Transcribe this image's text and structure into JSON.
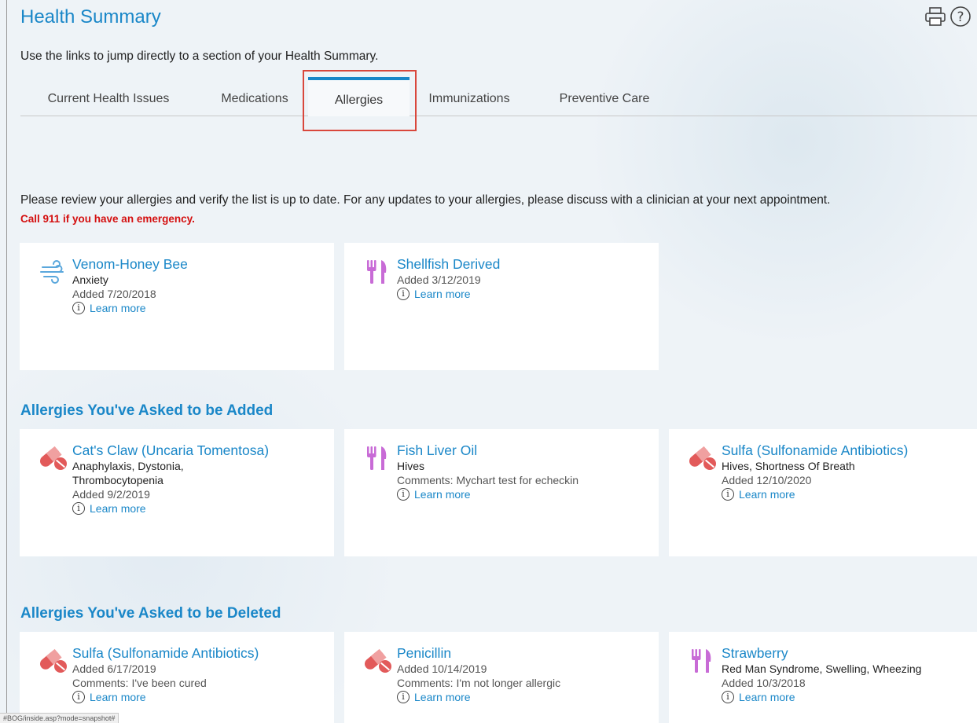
{
  "header": {
    "title": "Health Summary",
    "print_icon": "printer-icon",
    "help_icon": "help-icon"
  },
  "intro": "Use the links to jump directly to a section of your Health Summary.",
  "tabs": [
    {
      "label": "Current Health Issues",
      "active": false
    },
    {
      "label": "Medications",
      "active": false
    },
    {
      "label": "Allergies",
      "active": true
    },
    {
      "label": "Immunizations",
      "active": false
    },
    {
      "label": "Preventive Care",
      "active": false
    }
  ],
  "review_text": "Please review your allergies and verify the list is up to date. For any updates to your allergies, please discuss with a clinician at your next appointment.",
  "emergency_text": "Call 911 if you have an emergency.",
  "learn_more": "Learn more",
  "current_allergies": [
    {
      "icon": "wind-icon",
      "title": "Venom-Honey Bee",
      "reaction": "Anxiety",
      "added": "Added 7/20/2018"
    },
    {
      "icon": "fork-knife-icon",
      "title": "Shellfish Derived",
      "added": "Added 3/12/2019"
    }
  ],
  "added_section": {
    "title": "Allergies You've Asked to be Added",
    "items": [
      {
        "icon": "pill-icon",
        "title": "Cat's Claw (Uncaria Tomentosa)",
        "reaction_lines": [
          "Anaphylaxis, Dystonia,",
          "Thrombocytopenia"
        ],
        "added": "Added 9/2/2019"
      },
      {
        "icon": "fork-knife-icon",
        "title": "Fish Liver Oil",
        "reaction": "Hives",
        "comments": "Comments: Mychart test for echeckin"
      },
      {
        "icon": "pill-icon",
        "title": "Sulfa (Sulfonamide Antibiotics)",
        "reaction": "Hives, Shortness Of Breath",
        "added": "Added 12/10/2020"
      }
    ]
  },
  "deleted_section": {
    "title": "Allergies You've Asked to be Deleted",
    "items": [
      {
        "icon": "pill-icon",
        "title": "Sulfa (Sulfonamide Antibiotics)",
        "added": "Added 6/17/2019",
        "comments": "Comments: I've been cured"
      },
      {
        "icon": "pill-icon",
        "title": "Penicillin",
        "added": "Added 10/14/2019",
        "comments": "Comments: I'm not longer allergic"
      },
      {
        "icon": "fork-knife-icon",
        "title": "Strawberry",
        "reaction": "Red Man Syndrome, Swelling, Wheezing",
        "added": "Added 10/3/2018"
      }
    ]
  },
  "status_bar": "#BOG/inside.asp?mode=snapshot#",
  "colors": {
    "accent": "#1a87c8",
    "emergency": "#d40f0f",
    "pill": "#e25a5a",
    "food": "#c86bd6",
    "wind": "#5aa7dc",
    "highlight": "#d9473c"
  }
}
